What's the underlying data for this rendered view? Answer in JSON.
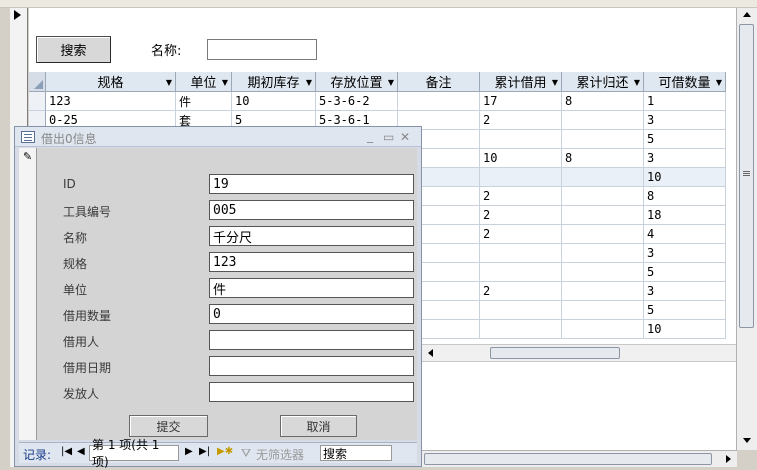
{
  "search": {
    "button_label": "搜索",
    "name_label": "名称:",
    "name_value": ""
  },
  "table": {
    "columns": [
      "规格",
      "单位",
      "期初库存",
      "存放位置",
      "备注",
      "累计借用",
      "累计归还",
      "可借数量"
    ],
    "rows": [
      [
        "123",
        "件",
        "10",
        "5-3-6-2",
        "",
        "17",
        "8",
        "1"
      ],
      [
        "0-25",
        "套",
        "5",
        "5-3-6-1",
        "",
        "2",
        "",
        "3"
      ],
      [
        "",
        "",
        "",
        "",
        "",
        "",
        "",
        "5"
      ],
      [
        "",
        "",
        "",
        "",
        "",
        "10",
        "8",
        "3"
      ],
      [
        "",
        "",
        "",
        "",
        "",
        "",
        "",
        "10"
      ],
      [
        "",
        "",
        "",
        "",
        "",
        "2",
        "",
        "8"
      ],
      [
        "",
        "",
        "",
        "",
        "",
        "2",
        "",
        "18"
      ],
      [
        "",
        "",
        "",
        "",
        "",
        "2",
        "",
        "4"
      ],
      [
        "",
        "",
        "",
        "",
        "",
        "",
        "",
        "3"
      ],
      [
        "",
        "",
        "",
        "",
        "",
        "",
        "",
        "5"
      ],
      [
        "",
        "",
        "",
        "",
        "",
        "2",
        "",
        "3"
      ],
      [
        "",
        "",
        "",
        "",
        "",
        "",
        "",
        "5"
      ],
      [
        "",
        "",
        "",
        "",
        "",
        "",
        "",
        "10"
      ]
    ]
  },
  "dialog": {
    "title": "借出0信息",
    "fields": [
      {
        "label": "ID",
        "value": "19"
      },
      {
        "label": "工具编号",
        "value": "005"
      },
      {
        "label": "名称",
        "value": "千分尺"
      },
      {
        "label": "规格",
        "value": "123"
      },
      {
        "label": "单位",
        "value": "件"
      },
      {
        "label": "借用数量",
        "value": "0"
      },
      {
        "label": "借用人",
        "value": ""
      },
      {
        "label": "借用日期",
        "value": ""
      },
      {
        "label": "发放人",
        "value": ""
      }
    ],
    "submit_label": "提交",
    "cancel_label": "取消",
    "nav": {
      "record_label": "记录:",
      "position": "第 1 项(共 1 项)",
      "filter_label": "无筛选器",
      "search_label": "搜索"
    }
  }
}
